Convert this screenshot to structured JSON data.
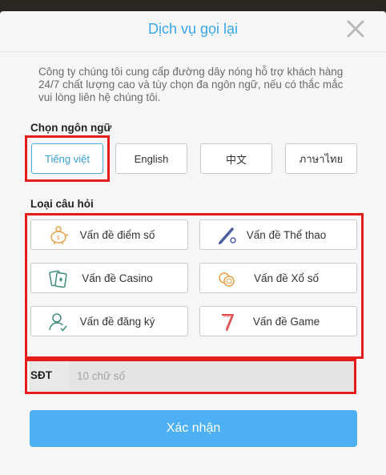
{
  "dialog": {
    "title": "Dịch vụ gọi lại",
    "description": "Công ty chúng tôi cung cấp đường dây nóng hỗ trợ khách hàng 24/7 chất lượng cao và tùy chọn đa ngôn ngữ, nếu có thắc mắc vui lòng liên hệ chúng tôi."
  },
  "language": {
    "label": "Chọn ngôn ngữ",
    "options": [
      "Tiếng việt",
      "English",
      "中文",
      "ภาษาไทย"
    ],
    "selected": "Tiếng việt"
  },
  "question": {
    "label": "Loại câu hỏi",
    "options": [
      {
        "label": "Vấn đề điểm số",
        "icon": "piggy-bank-icon"
      },
      {
        "label": "Vấn đề Thể thao",
        "icon": "baseball-bat-icon"
      },
      {
        "label": "Vấn đề Casino",
        "icon": "playing-cards-icon"
      },
      {
        "label": "Vấn đề Xổ số",
        "icon": "coins-icon"
      },
      {
        "label": "Vấn đề đăng ký",
        "icon": "user-check-icon"
      },
      {
        "label": "Vấn đề Game",
        "icon": "seven-icon"
      }
    ]
  },
  "phone": {
    "label": "SĐT",
    "placeholder": "10 chữ số",
    "value": ""
  },
  "submit_label": "Xác nhận",
  "colors": {
    "accent": "#3aa6e6",
    "button": "#4db0f4",
    "highlight": "#e51c1c",
    "icon_orange": "#e6a045",
    "icon_blue": "#4a5fa0",
    "icon_green": "#3f8a7a",
    "icon_red": "#e04a4a"
  }
}
